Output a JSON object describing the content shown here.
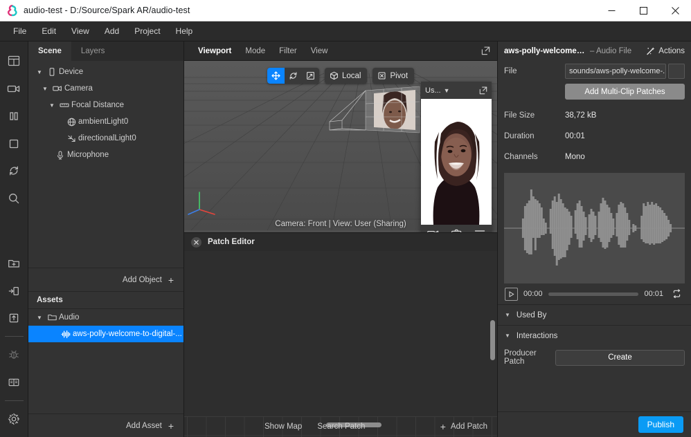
{
  "titlebar": {
    "title": "audio-test - D:/Source/Spark AR/audio-test",
    "logo_icon": "spark-ar-logo-icon",
    "minimize": "—",
    "maximize": "□",
    "close": "✕"
  },
  "menubar": {
    "items": [
      {
        "label": "File"
      },
      {
        "label": "Edit"
      },
      {
        "label": "View"
      },
      {
        "label": "Add"
      },
      {
        "label": "Project"
      },
      {
        "label": "Help"
      }
    ]
  },
  "rail": {
    "items": [
      {
        "name": "layout-icon"
      },
      {
        "name": "video-camera-icon"
      },
      {
        "name": "pause-icon"
      },
      {
        "name": "stop-square-icon"
      },
      {
        "name": "reset-loop-icon"
      },
      {
        "name": "search-icon"
      },
      {
        "name": "add-folder-icon"
      },
      {
        "name": "import-icon"
      },
      {
        "name": "export-icon"
      },
      {
        "name": "bug-icon"
      },
      {
        "name": "book-icon"
      },
      {
        "name": "gear-icon"
      }
    ]
  },
  "left_panel": {
    "tabs": [
      {
        "label": "Scene",
        "active": true
      },
      {
        "label": "Layers",
        "active": false
      }
    ],
    "tree": [
      {
        "label": "Device",
        "icon": "device-icon",
        "depth": 0,
        "tri": "▼"
      },
      {
        "label": "Camera",
        "icon": "camera-icon",
        "depth": 1,
        "tri": "▼"
      },
      {
        "label": "Focal Distance",
        "icon": "focal-distance-icon",
        "depth": 2,
        "tri": "▼"
      },
      {
        "label": "ambientLight0",
        "icon": "ambient-light-icon",
        "depth": 3,
        "tri": ""
      },
      {
        "label": "directionalLight0",
        "icon": "directional-light-icon",
        "depth": 3,
        "tri": ""
      },
      {
        "label": "Microphone",
        "icon": "microphone-icon",
        "depth": 2,
        "tri": ""
      }
    ],
    "add_object": {
      "label": "Add Object",
      "plus": "+"
    },
    "assets_header": "Assets",
    "assets": [
      {
        "label": "Audio",
        "icon": "folder-icon",
        "depth": 0,
        "tri": "▼",
        "selected": false
      },
      {
        "label": "aws-polly-welcome-to-digital-...",
        "icon": "audio-wave-icon",
        "depth": 1,
        "tri": "",
        "selected": true
      }
    ],
    "add_asset": {
      "label": "Add Asset",
      "plus": "+"
    }
  },
  "viewport": {
    "menus": [
      {
        "label": "Viewport",
        "strong": true
      },
      {
        "label": "Mode",
        "strong": false
      },
      {
        "label": "Filter",
        "strong": false
      },
      {
        "label": "View",
        "strong": false
      }
    ],
    "expand_icon": "expand-icon",
    "tools": {
      "move_icon": "move-tool-icon",
      "rotate_icon": "rotate-tool-icon",
      "scale_icon": "scale-tool-icon",
      "local_label": "Local",
      "local_icon": "cube-icon",
      "pivot_label": "Pivot",
      "pivot_icon": "pivot-icon"
    },
    "status": "Camera: Front | View: User (Sharing)",
    "preview": {
      "label": "Us...",
      "chevron": "▼",
      "expand_icon": "expand-icon",
      "record_icon": "video-record-icon",
      "screenshot_icon": "camera-rotate-icon",
      "menu_icon": "hamburger-icon"
    }
  },
  "patch_editor": {
    "close_icon": "close-icon",
    "title": "Patch Editor",
    "show_map": "Show Map",
    "search_patch": "Search Patch",
    "add_patch": "Add Patch",
    "add_patch_plus": "+"
  },
  "inspector": {
    "title": "aws-polly-welcome-t...",
    "subtitle": "– Audio File",
    "actions_label": "Actions",
    "actions_icon": "magic-wand-icon",
    "file_label": "File",
    "file_value": "sounds/aws-polly-welcome-...",
    "browse_icon": "browse-icon",
    "multiclip_label": "Add Multi-Clip Patches",
    "file_size_label": "File Size",
    "file_size_value": "38,72 kB",
    "duration_label": "Duration",
    "duration_value": "00:01",
    "channels_label": "Channels",
    "channels_value": "Mono",
    "transport": {
      "play_icon": "play-icon",
      "current_time": "00:00",
      "total_time": "00:01",
      "loop_icon": "loop-icon"
    },
    "used_by_label": "Used By",
    "interactions_label": "Interactions",
    "producer_patch_label": "Producer Patch",
    "create_label": "Create",
    "publish_label": "Publish"
  },
  "colors": {
    "accent": "#0a84ff",
    "publish": "#0a9bf5",
    "panel": "#333333",
    "chrome": "#2b2b2b",
    "viewport": "#4f4f4f"
  }
}
